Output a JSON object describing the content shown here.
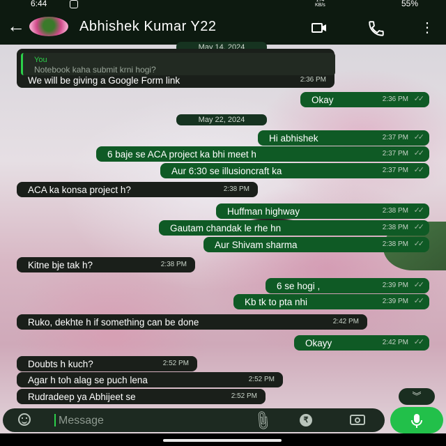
{
  "status_bar": {
    "time": "6:44",
    "speed_value": "174",
    "speed_unit": "KB/s",
    "battery": "55%"
  },
  "header": {
    "back_glyph": "←",
    "contact_name": "Abhishek Kumar Y22"
  },
  "colors": {
    "outgoing_bubble": "#0f5a25",
    "incoming_bubble": "#1a1f1a",
    "accent": "#22c04a",
    "header_bg": "#0d1a10"
  },
  "chat": {
    "dates": [
      "May 14, 2024",
      "May 22, 2024"
    ],
    "quote": {
      "author": "You",
      "text": "Notebook kaha submit krni hogi?"
    },
    "messages": [
      {
        "dir": "in",
        "text": "We will be giving a Google Form link",
        "time": "2:36 PM"
      },
      {
        "dir": "out",
        "text": "Okay",
        "time": "2:36 PM"
      },
      {
        "dir": "out",
        "text": "Hi abhishek",
        "time": "2:37 PM"
      },
      {
        "dir": "out",
        "text": "6 baje se ACA project ka bhi meet h",
        "time": "2:37 PM"
      },
      {
        "dir": "out",
        "text": "Aur 6:30 se illusioncraft ka",
        "time": "2:37 PM"
      },
      {
        "dir": "in",
        "text": "ACA ka konsa project h?",
        "time": "2:38 PM"
      },
      {
        "dir": "out",
        "text": "Huffman highway",
        "time": "2:38 PM"
      },
      {
        "dir": "out",
        "text": "Gautam chandak le rhe hn",
        "time": "2:38 PM"
      },
      {
        "dir": "out",
        "text": "Aur Shivam sharma",
        "time": "2:38 PM"
      },
      {
        "dir": "in",
        "text": "Kitne bje tak h?",
        "time": "2:38 PM"
      },
      {
        "dir": "out",
        "text": "6 se hogi ,",
        "time": "2:39 PM"
      },
      {
        "dir": "out",
        "text": "Kb tk to pta nhi",
        "time": "2:39 PM"
      },
      {
        "dir": "in",
        "text": "Ruko, dekhte h if something can be done",
        "time": "2:42 PM"
      },
      {
        "dir": "out",
        "text": "Okayy",
        "time": "2:42 PM"
      },
      {
        "dir": "in",
        "text": "Doubts h kuch?",
        "time": "2:52 PM"
      },
      {
        "dir": "in",
        "text": "Agar h toh alag se puch lena",
        "time": "2:52 PM"
      },
      {
        "dir": "in",
        "text": "Rudradeep ya Abhijeet se",
        "time": "2:52 PM"
      }
    ]
  },
  "composer": {
    "placeholder": "Message",
    "rupee_glyph": "₹"
  },
  "icons": [
    "instagram-icon",
    "back-arrow-icon",
    "video-call-icon",
    "phone-call-icon",
    "more-vert-icon",
    "read-ticks-icon",
    "scroll-down-icon",
    "emoji-icon",
    "attach-icon",
    "rupee-payment-icon",
    "camera-icon",
    "mic-icon"
  ]
}
